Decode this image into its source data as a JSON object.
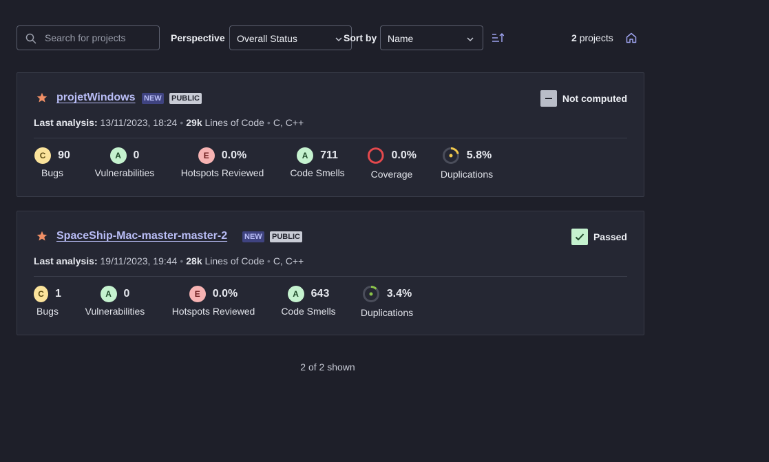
{
  "search": {
    "placeholder": "Search for projects",
    "icon": "search-icon"
  },
  "perspective": {
    "label": "Perspective",
    "value": "Overall Status"
  },
  "sort": {
    "label": "Sort by",
    "value": "Name",
    "direction_icon": "sort-ascending-icon"
  },
  "count": {
    "number": "2",
    "label": "projects"
  },
  "projects": [
    {
      "name": "projetWindows",
      "tags": [
        "NEW",
        "PUBLIC"
      ],
      "status": "Not computed",
      "last_analysis_label": "Last analysis:",
      "last_analysis": "13/11/2023, 18:24",
      "loc": "29k",
      "loc_label": "Lines of Code",
      "languages": "C, C++",
      "metrics": {
        "bugs": {
          "rating": "C",
          "value": "90",
          "label": "Bugs"
        },
        "vulnerabilities": {
          "rating": "A",
          "value": "0",
          "label": "Vulnerabilities"
        },
        "hotspots": {
          "rating": "E",
          "value": "0.0%",
          "label": "Hotspots Reviewed"
        },
        "code_smells": {
          "rating": "A",
          "value": "711",
          "label": "Code Smells"
        },
        "coverage": {
          "value": "0.0%",
          "label": "Coverage"
        },
        "duplications": {
          "value": "5.8%",
          "label": "Duplications"
        }
      }
    },
    {
      "name": "SpaceShip-Mac-master-master-2",
      "tags": [
        "NEW",
        "PUBLIC"
      ],
      "status": "Passed",
      "last_analysis_label": "Last analysis:",
      "last_analysis": "19/11/2023, 19:44",
      "loc": "28k",
      "loc_label": "Lines of Code",
      "languages": "C, C++",
      "metrics": {
        "bugs": {
          "rating": "C",
          "value": "1",
          "label": "Bugs"
        },
        "vulnerabilities": {
          "rating": "A",
          "value": "0",
          "label": "Vulnerabilities"
        },
        "hotspots": {
          "rating": "E",
          "value": "0.0%",
          "label": "Hotspots Reviewed"
        },
        "code_smells": {
          "rating": "A",
          "value": "643",
          "label": "Code Smells"
        },
        "duplications": {
          "value": "3.4%",
          "label": "Duplications"
        }
      }
    }
  ],
  "footer": "2 of 2 shown",
  "colors": {
    "background": "#1e1f29",
    "card": "#252733",
    "link": "#b9bdf6",
    "star": "#f08f66",
    "passed": "#c5f2cf",
    "coverage_ring": "#e5494d"
  }
}
